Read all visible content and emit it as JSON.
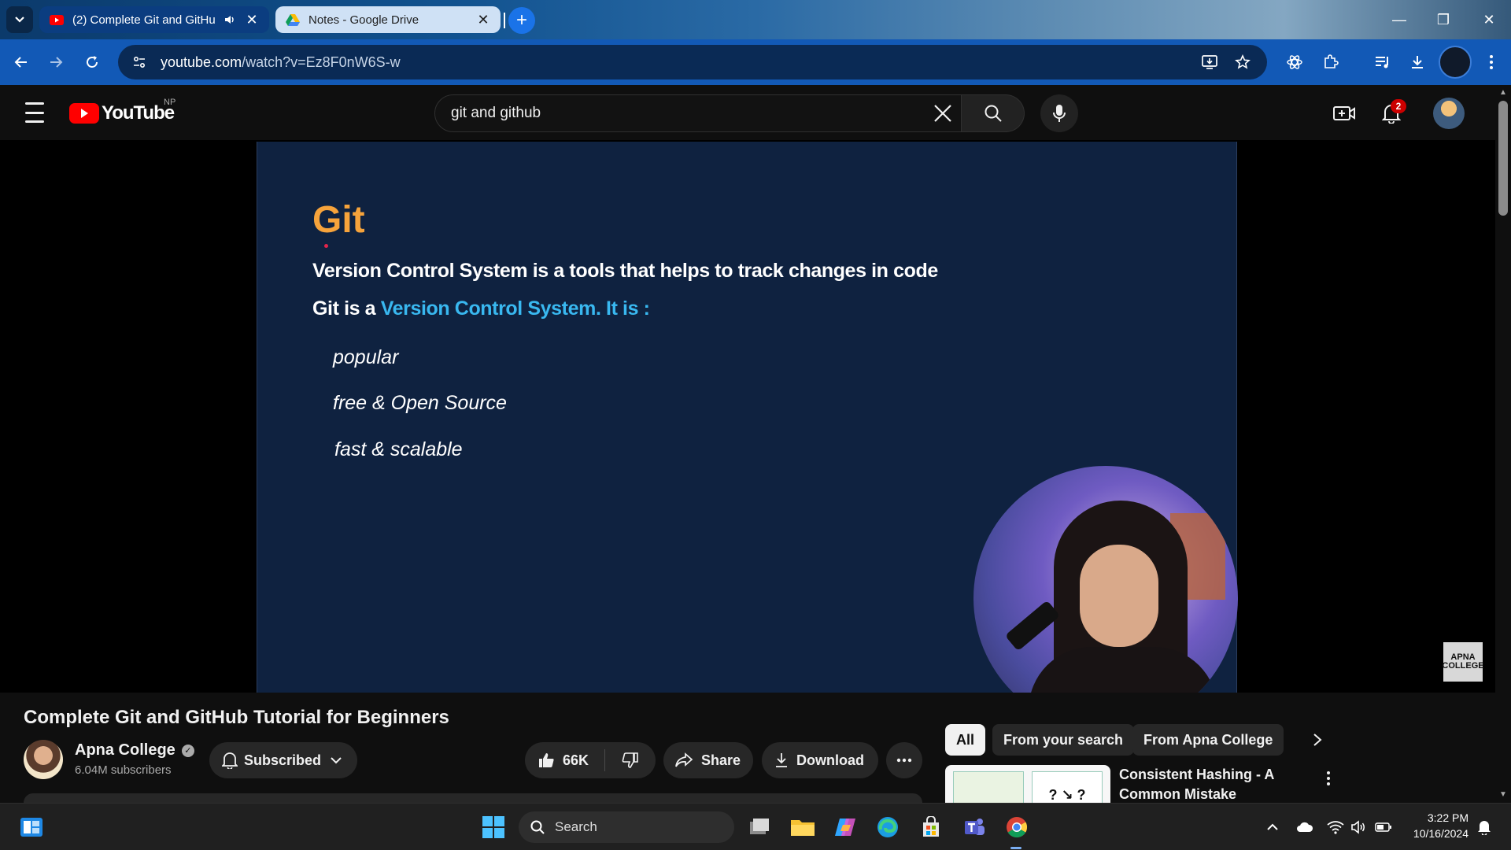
{
  "browser": {
    "tabs": [
      {
        "title": "(2) Complete Git and GitHub Tutorial for Beginners - YouTube",
        "favicon": "youtube-icon",
        "audio": true,
        "active": true
      },
      {
        "title": "Notes - Google Drive",
        "favicon": "google-drive-icon",
        "audio": false,
        "active": false
      }
    ],
    "url_host": "youtube.com",
    "url_path": "/watch?v=Ez8F0nW6S-w",
    "accent_color": "#1259b6"
  },
  "youtube": {
    "logo_text": "YouTube",
    "country_code": "NP",
    "search_value": "git and github",
    "notification_count": "2"
  },
  "slide": {
    "title": "Git",
    "line1": "Version Control System is a tools that helps to track changes in code",
    "line2_prefix": "Git is a ",
    "line2_highlight": "Version Control System. It is :",
    "items": [
      "popular",
      "free & Open Source",
      "fast & scalable"
    ],
    "watermark": "APNA COLLEGE",
    "title_color": "#f6a33b",
    "highlight_color": "#39b8f0"
  },
  "video": {
    "title": "Complete Git and GitHub Tutorial for Beginners",
    "channel_name": "Apna College",
    "subscribers": "6.04M subscribers",
    "subscribe_label": "Subscribed",
    "likes": "66K",
    "share_label": "Share",
    "download_label": "Download"
  },
  "sidebar": {
    "chips": [
      "All",
      "From your search",
      "From Apna College"
    ],
    "recommendation_title": "Consistent Hashing - A Common Mistake",
    "thumb_text": "? ↘ ?"
  },
  "taskbar": {
    "search_placeholder": "Search",
    "time": "3:22 PM",
    "date": "10/16/2024"
  }
}
